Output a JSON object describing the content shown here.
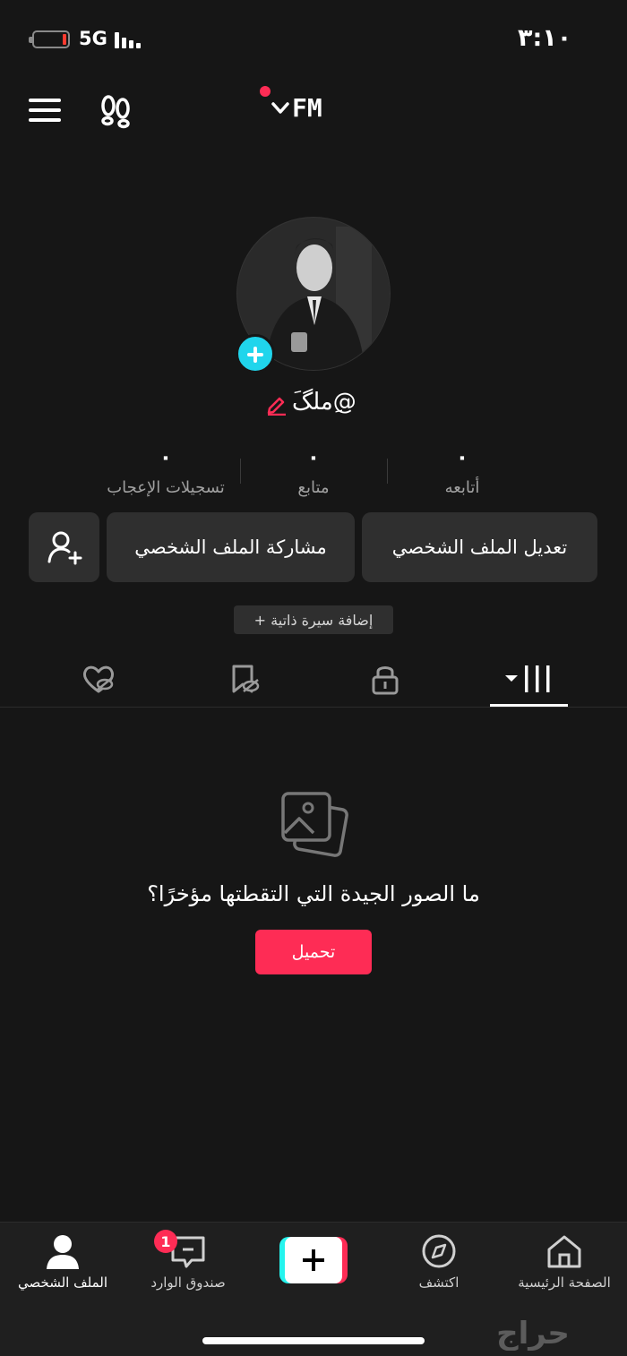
{
  "status_bar": {
    "network": "5G",
    "time": "٣:١٠",
    "battery_level": 0.08
  },
  "header": {
    "account_name": "FM",
    "menu_icon": "hamburger-menu-icon",
    "footprint_icon": "footprints-icon"
  },
  "profile": {
    "username": "@ِملگَ",
    "stats": [
      {
        "value": "٠",
        "label": "أتابعه"
      },
      {
        "value": "٠",
        "label": "متابع"
      },
      {
        "value": "٠",
        "label": "تسجيلات الإعجاب"
      }
    ],
    "edit_profile_label": "تعديل الملف الشخصي",
    "share_profile_label": "مشاركة الملف الشخصي",
    "add_bio_label": "+ إضافة سيرة ذاتية"
  },
  "tabs": [
    "videos-grid-icon",
    "lock-icon",
    "favorites-hidden-icon",
    "liked-hidden-icon"
  ],
  "empty_state": {
    "message": "ما الصور الجيدة التي التقطتها مؤخرًا؟",
    "upload_label": "تحميل"
  },
  "bottom_nav": {
    "items": [
      {
        "label": "الصفحة الرئيسية",
        "icon": "home-icon"
      },
      {
        "label": "اكتشف",
        "icon": "compass-icon"
      },
      {
        "label": "",
        "icon": "create-plus-icon"
      },
      {
        "label": "صندوق الوارد",
        "icon": "inbox-icon",
        "badge": "1"
      },
      {
        "label": "الملف الشخصي",
        "icon": "profile-icon"
      }
    ]
  },
  "watermark": "حراج",
  "colors": {
    "background": "#161616",
    "button": "#2f2f2f",
    "accent": "#fe2c55",
    "cyan": "#20d5ec"
  }
}
